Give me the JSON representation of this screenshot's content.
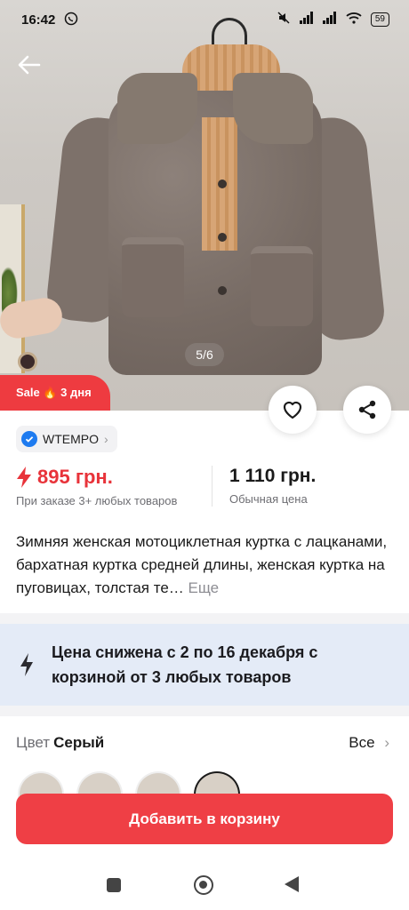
{
  "status_bar": {
    "time": "16:42",
    "battery": "59",
    "icons": [
      "whatsapp-icon",
      "mute-icon",
      "signal-icon",
      "signal-icon",
      "wifi-icon",
      "battery-icon"
    ]
  },
  "hero": {
    "image_counter": "5/6",
    "sale_badge": "Sale 🔥 3 дня"
  },
  "seller": {
    "name": "WTEMPO"
  },
  "price": {
    "sale_price": "895 грн.",
    "sale_note": "При заказе 3+ любых товаров",
    "regular_price": "1 110 грн.",
    "regular_note": "Обычная цена"
  },
  "description": {
    "text": "Зимняя женская мотоциклетная куртка с лацканами, бархатная куртка средней длины, женская куртка на пуговицах, толстая те…",
    "more": "Еще"
  },
  "promo": {
    "text": "Цена снижена с 2 по 16 декабря с корзиной от 3 любых товаров"
  },
  "color": {
    "label": "Цвет",
    "value": "Серый",
    "all_link": "Все"
  },
  "actions": {
    "add_to_cart": "Добавить в корзину"
  },
  "colors": {
    "accent": "#ef3f45",
    "promo_bg": "#e4ebf7",
    "verified": "#1e7bf0"
  }
}
